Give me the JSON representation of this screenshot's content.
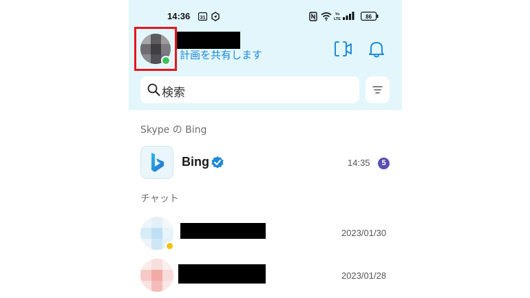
{
  "status_bar": {
    "time": "14:36",
    "calendar_badge": "31",
    "battery": "86"
  },
  "header": {
    "mood_message": "計画を共有します",
    "video_call_icon": "video-call-icon",
    "notification_icon": "bell-icon"
  },
  "search": {
    "placeholder": "検索",
    "icon": "search-icon",
    "filter_icon": "filter-icon"
  },
  "sections": {
    "bing_section": "Skype の Bing",
    "chats_section": "チャット"
  },
  "bing_row": {
    "name": "Bing",
    "time": "14:35",
    "unread": "5"
  },
  "chats": [
    {
      "date": "2023/01/30",
      "status": "away"
    },
    {
      "date": "2023/01/28",
      "status": "none"
    }
  ],
  "colors": {
    "header_bg": "#e2f6fb",
    "accent": "#1f8ad6",
    "online": "#3ec35a",
    "away": "#f2c211",
    "unread_badge": "#5b4fb0",
    "highlight_box": "#e8141b"
  }
}
